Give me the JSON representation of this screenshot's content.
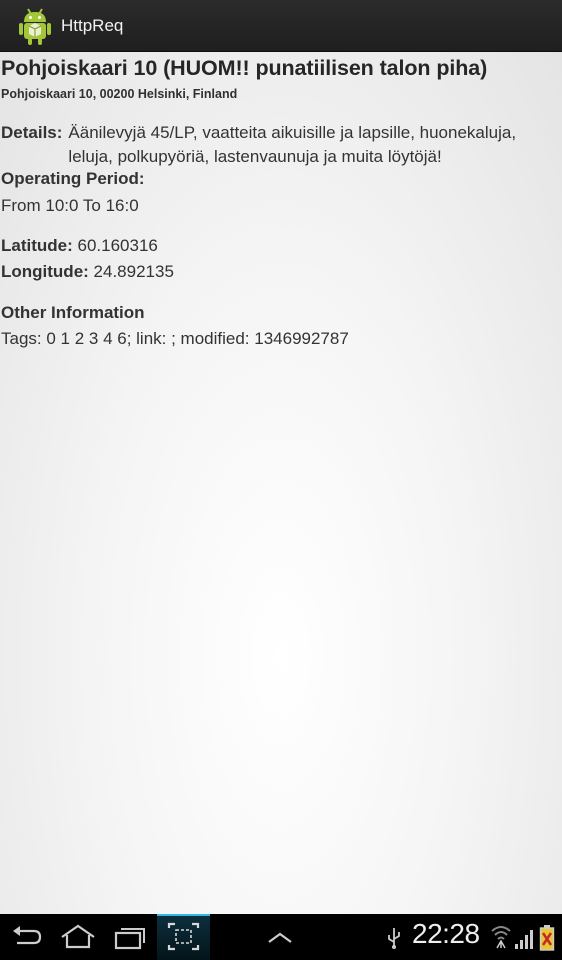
{
  "app": {
    "title": "HttpReq",
    "icon": "android-robot-icon"
  },
  "place": {
    "title": "Pohjoiskaari 10 (HUOM!! punatiilisen talon piha)",
    "address": "Pohjoiskaari 10, 00200 Helsinki, Finland"
  },
  "details": {
    "label": "Details:",
    "text": "Äänilevyjä 45/LP, vaatteita aikuisille ja lapsille, huonekaluja, leluja, polkupyöriä, lastenvaunuja ja muita löytöjä!"
  },
  "operating": {
    "label": "Operating Period:",
    "value": "From 10:0 To 16:0"
  },
  "latitude": {
    "label": "Latitude:",
    "value": "60.160316"
  },
  "longitude": {
    "label": "Longitude:",
    "value": "24.892135"
  },
  "other": {
    "label": "Other Information",
    "value": "Tags: 0 1 2 3 4 6; link: ; modified: 1346992787"
  },
  "statusbar": {
    "time": "22:28",
    "icons": [
      "back-icon",
      "home-icon",
      "recent-apps-icon",
      "screenshot-icon",
      "menu-up-icon",
      "usb-icon",
      "wifi-icon",
      "signal-icon",
      "battery-icon"
    ]
  },
  "colors": {
    "accent": "#33b5e5",
    "android_green": "#a4c639",
    "battery": "#e8c832"
  }
}
